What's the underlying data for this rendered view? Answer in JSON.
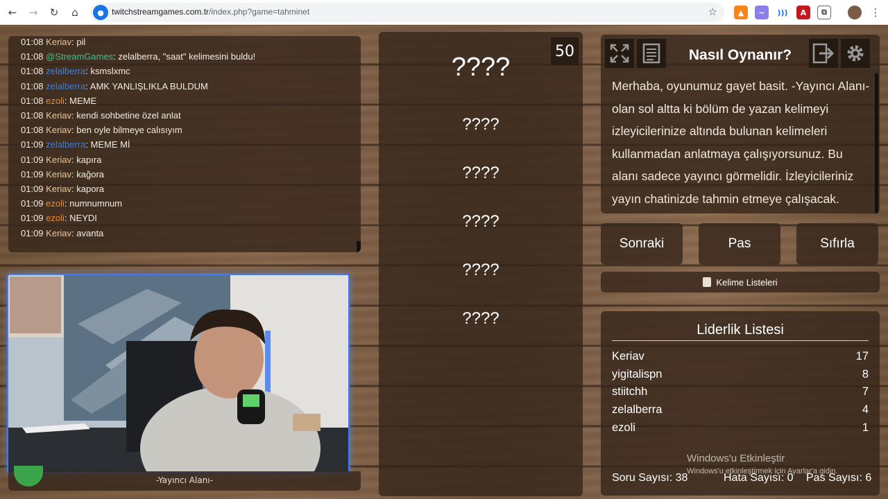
{
  "browser": {
    "url_domain": "twitchstreamgames.com.tr",
    "url_path": "/index.php?game=tahminet"
  },
  "chat": {
    "messages": [
      {
        "time": "01:08",
        "user": "Keriav",
        "text": ": pil",
        "color": "#e8c79a"
      },
      {
        "time": "01:08",
        "user": "@StreamGames",
        "text": ": zelalberra, \"saat\" kelimesini buldu!",
        "color": "#3fbf8a"
      },
      {
        "time": "01:08",
        "user": "zelalberra",
        "text": ": ksmslxmc",
        "color": "#3f7fdc"
      },
      {
        "time": "01:08",
        "user": "zelalberra",
        "text": ": AMK YANLIŞLIKLA BULDUM",
        "color": "#3f7fdc"
      },
      {
        "time": "01:08",
        "user": "ezoli",
        "text": ": MEME",
        "color": "#f08a2c"
      },
      {
        "time": "01:08",
        "user": "Keriav",
        "text": ": kendi sohbetine özel anlat",
        "color": "#e8c79a"
      },
      {
        "time": "01:08",
        "user": "Keriav",
        "text": ": ben oyle bilmeye calısıyım",
        "color": "#e8c79a"
      },
      {
        "time": "01:09",
        "user": "zelalberra",
        "text": ": MEME Mİ",
        "color": "#3f7fdc"
      },
      {
        "time": "01:09",
        "user": "Keriav",
        "text": ": kapıra",
        "color": "#e8c79a"
      },
      {
        "time": "01:09",
        "user": "Keriav",
        "text": ": kağora",
        "color": "#e8c79a"
      },
      {
        "time": "01:09",
        "user": "Keriav",
        "text": ": kapora",
        "color": "#e8c79a"
      },
      {
        "time": "01:09",
        "user": "ezoli",
        "text": ": numnumnum",
        "color": "#f08a2c"
      },
      {
        "time": "01:09",
        "user": "ezoli",
        "text": ": NEYDI",
        "color": "#f08a2c"
      },
      {
        "time": "01:09",
        "user": "Keriav",
        "text": ": avanta",
        "color": "#e8c79a"
      }
    ]
  },
  "streamer_area_label": "-Yayıncı Alanı-",
  "words": {
    "counter": "50",
    "items": [
      "????",
      "????",
      "????",
      "????",
      "????",
      "????"
    ]
  },
  "how_to": {
    "title": "Nasıl Oynanır?",
    "text": "Merhaba, oyunumuz gayet basit. -Yayıncı Alanı- olan sol altta ki bölüm de yazan kelimeyi izleyicilerinize altında bulunan kelimeleri kullanmadan anlatmaya çalışıyorsunuz. Bu alanı sadece yayıncı görmelidir. İzleyicileriniz yayın chatinizde tahmin etmeye çalışacak."
  },
  "buttons": {
    "next": "Sonraki",
    "pass": "Pas",
    "reset": "Sıfırla",
    "word_lists": "Kelime Listeleri"
  },
  "leaderboard": {
    "title": "Liderlik Listesi",
    "rows": [
      {
        "name": "Keriav",
        "score": "17"
      },
      {
        "name": "yigitalispn",
        "score": "8"
      },
      {
        "name": "stiitchh",
        "score": "7"
      },
      {
        "name": "zelalberra",
        "score": "4"
      },
      {
        "name": "ezoli",
        "score": "1"
      }
    ]
  },
  "stats": {
    "questions": "Soru Sayısı: 38",
    "errors": "Hata Sayısı: 0",
    "passes": "Pas Sayısı: 6"
  },
  "watermark": {
    "title": "Windows'u Etkinleştir",
    "subtitle": "Windows'u etkinleştirmek için Ayarlar'a gidin."
  }
}
